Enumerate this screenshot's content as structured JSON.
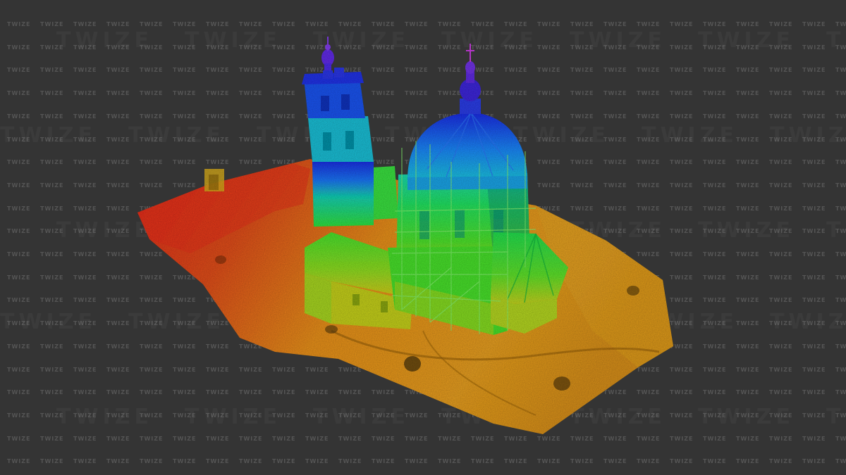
{
  "watermark": {
    "text": "TWIZE",
    "color": "#555555"
  },
  "scene": {
    "subject": "point-cloud-church-height-map",
    "colormap": [
      "#0a1ad8",
      "#1d8cf0",
      "#17c9c2",
      "#2fd43a",
      "#c8c41e",
      "#e6941e",
      "#e0501c",
      "#d6261a"
    ]
  }
}
